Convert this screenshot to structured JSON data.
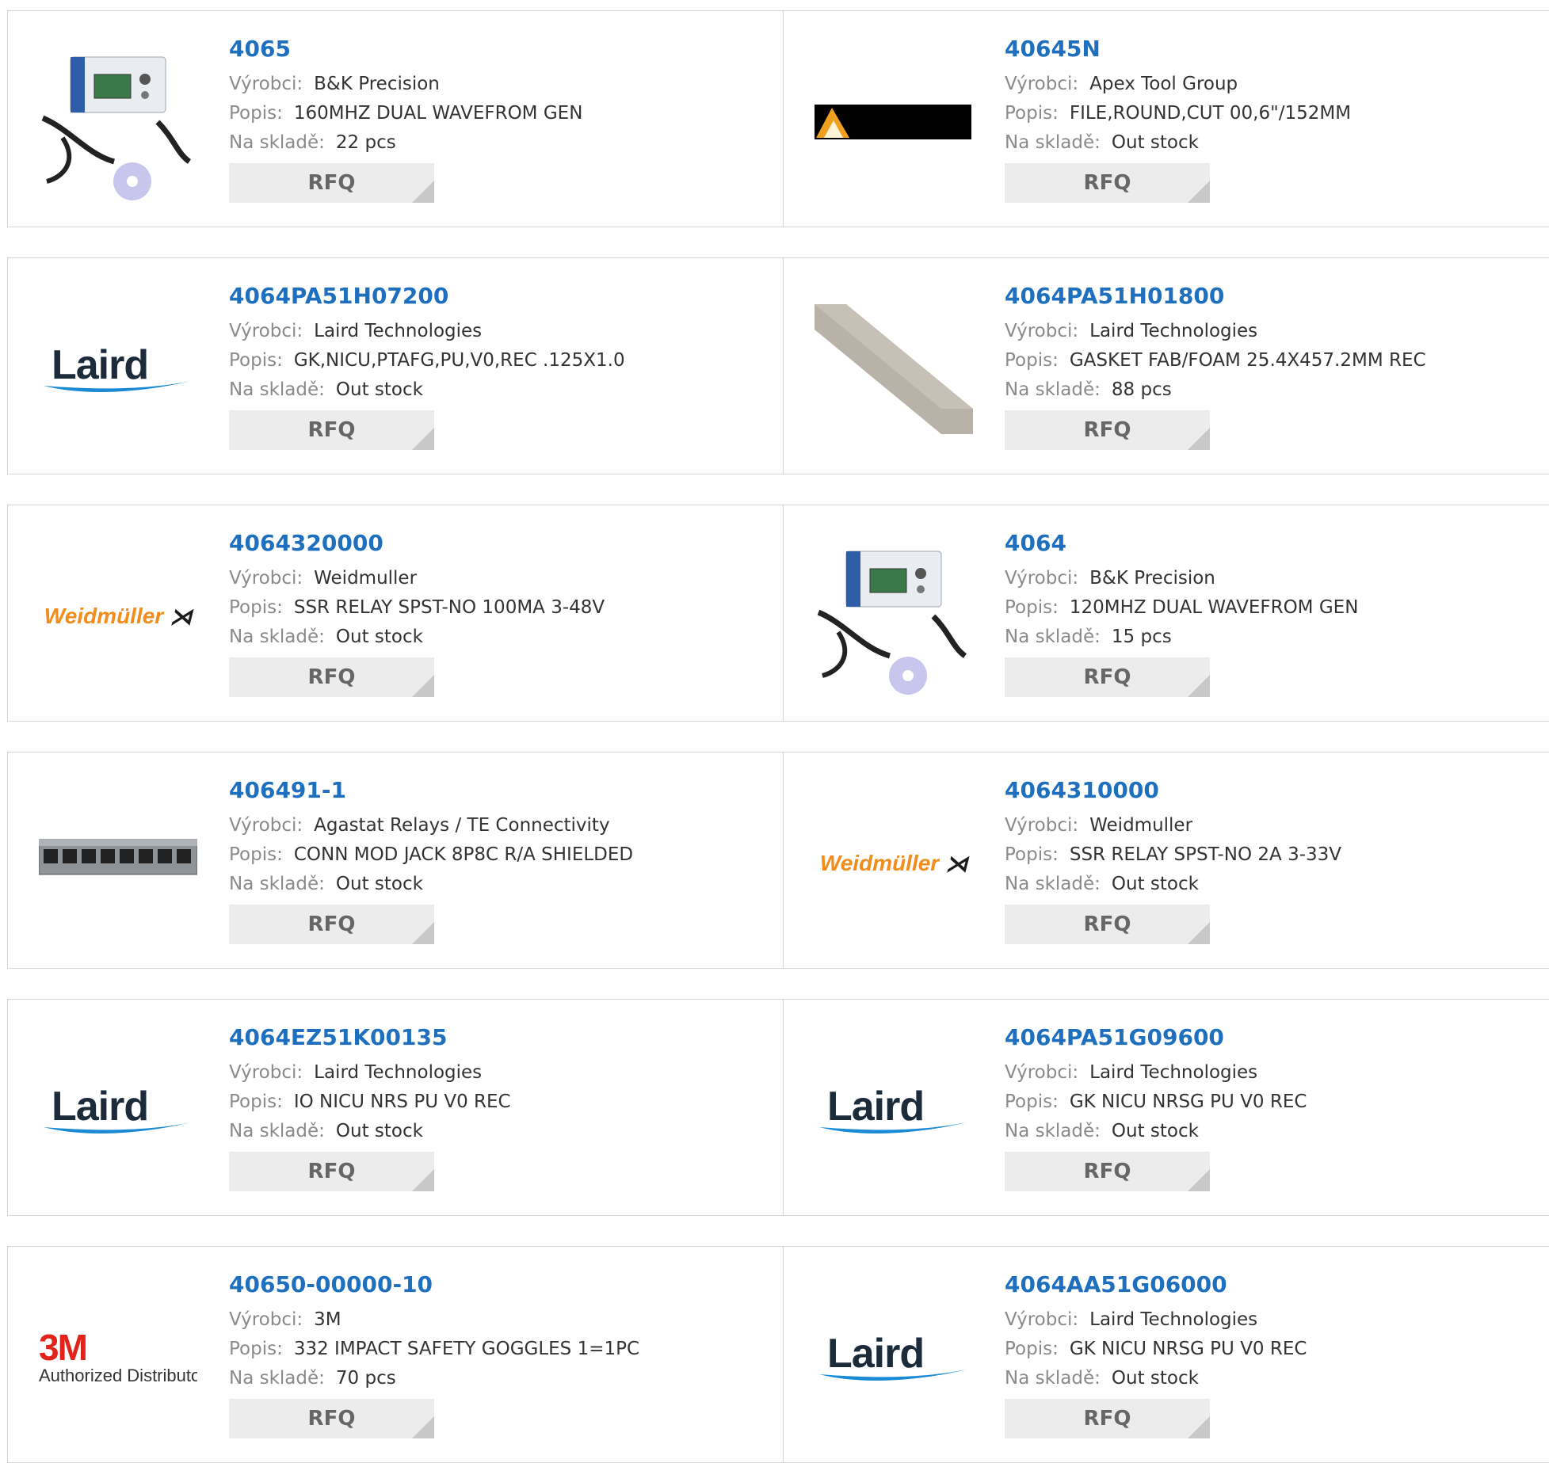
{
  "labels": {
    "manufacturer": "Výrobci:",
    "description": "Popis:",
    "stock": "Na skladě:",
    "rfq": "RFQ"
  },
  "logos": {
    "laird": "Laird",
    "weidmuller": "Weidmüller",
    "weidmuller_symbol": "⋊",
    "threem_mark": "3M",
    "threem_sub": "Authorized Distributor"
  },
  "colors": {
    "title": "#1f6fbf",
    "weidmuller": "#f28c1a",
    "threem": "#e2231a",
    "laird_swoosh": "#1a8ad4"
  },
  "products": [
    {
      "part": "4065",
      "manufacturer": "B&K Precision",
      "description": "160MHZ DUAL WAVEFROM GEN",
      "stock": "22 pcs",
      "image": "function-generator"
    },
    {
      "part": "40645N",
      "manufacturer": "Apex Tool Group",
      "description": "FILE,ROUND,CUT 00,6\"/152MM",
      "stock": "Out stock",
      "image": "apex-logo"
    },
    {
      "part": "4064PA51H07200",
      "manufacturer": "Laird Technologies",
      "description": "GK,NICU,PTAFG,PU,V0,REC .125X1.0",
      "stock": "Out stock",
      "image": "laird-logo"
    },
    {
      "part": "4064PA51H01800",
      "manufacturer": "Laird Technologies",
      "description": "GASKET FAB/FOAM 25.4X457.2MM REC",
      "stock": "88 pcs",
      "image": "gasket-strip"
    },
    {
      "part": "4064320000",
      "manufacturer": "Weidmuller",
      "description": "SSR RELAY SPST-NO 100MA 3-48V",
      "stock": "Out stock",
      "image": "weidmuller-logo"
    },
    {
      "part": "4064",
      "manufacturer": "B&K Precision",
      "description": "120MHZ DUAL WAVEFROM GEN",
      "stock": "15 pcs",
      "image": "function-generator"
    },
    {
      "part": "406491-1",
      "manufacturer": "Agastat Relays / TE Connectivity",
      "description": "CONN MOD JACK 8P8C R/A SHIELDED",
      "stock": "Out stock",
      "image": "modular-jack"
    },
    {
      "part": "4064310000",
      "manufacturer": "Weidmuller",
      "description": "SSR RELAY SPST-NO 2A 3-33V",
      "stock": "Out stock",
      "image": "weidmuller-logo"
    },
    {
      "part": "4064EZ51K00135",
      "manufacturer": "Laird Technologies",
      "description": "IO NICU NRS PU V0 REC",
      "stock": "Out stock",
      "image": "laird-logo"
    },
    {
      "part": "4064PA51G09600",
      "manufacturer": "Laird Technologies",
      "description": "GK NICU NRSG PU V0 REC",
      "stock": "Out stock",
      "image": "laird-logo"
    },
    {
      "part": "40650-00000-10",
      "manufacturer": "3M",
      "description": "332 IMPACT SAFETY GOGGLES 1=1PC",
      "stock": "70 pcs",
      "image": "3m-logo"
    },
    {
      "part": "4064AA51G06000",
      "manufacturer": "Laird Technologies",
      "description": "GK NICU NRSG PU V0 REC",
      "stock": "Out stock",
      "image": "laird-logo"
    }
  ]
}
